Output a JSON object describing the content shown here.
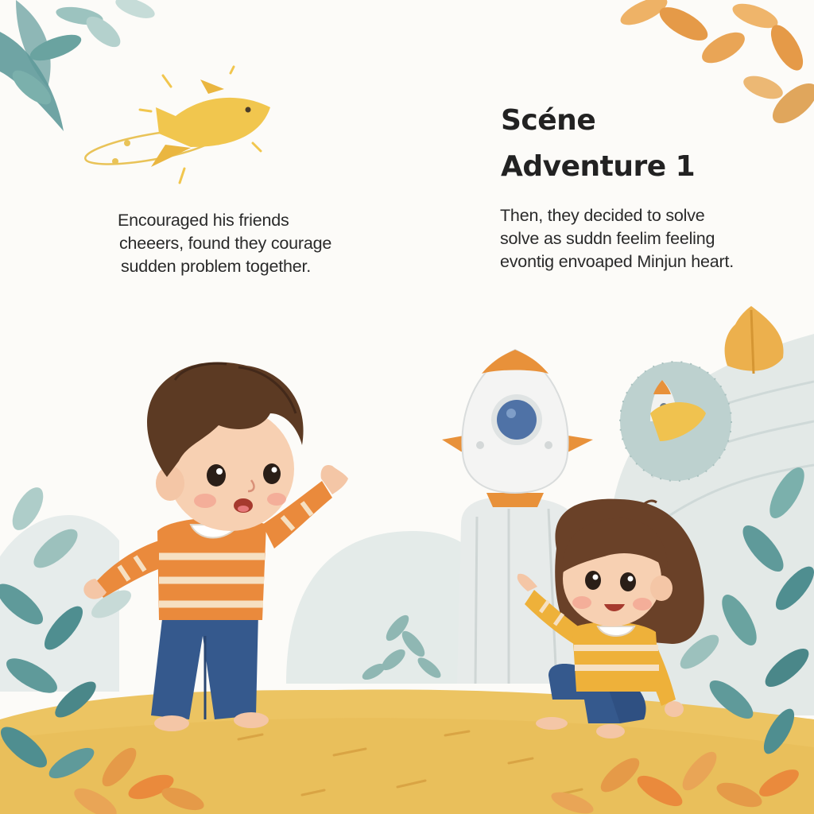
{
  "page": {
    "title_line1": "Scéne",
    "title_line2": "Adventure 1",
    "left_text": [
      "Encouraged his friends",
      "cheeers, found they courage",
      "sudden problem together."
    ],
    "right_text": [
      "Then, they decided to solve",
      "solve as suddn feelim feeling",
      "evontig envoaped Minjun heart."
    ]
  },
  "colors": {
    "background": "#fcfbf8",
    "ground": "#ecc462",
    "sweater_orange": "#ea8a3c",
    "sweater_yellow": "#eeb13a",
    "pants_blue": "#35598d",
    "hair_brown": "#5c3a23",
    "foliage_teal": "#5f9a9a",
    "foliage_orange": "#e59a48",
    "rocket_accent": "#e8913a",
    "rocket_window": "#4f72a6"
  },
  "icons": {
    "flying_creature": "yellow-fish-comet",
    "rocket": "white-rocket",
    "small_rocket": "small-rocket"
  }
}
